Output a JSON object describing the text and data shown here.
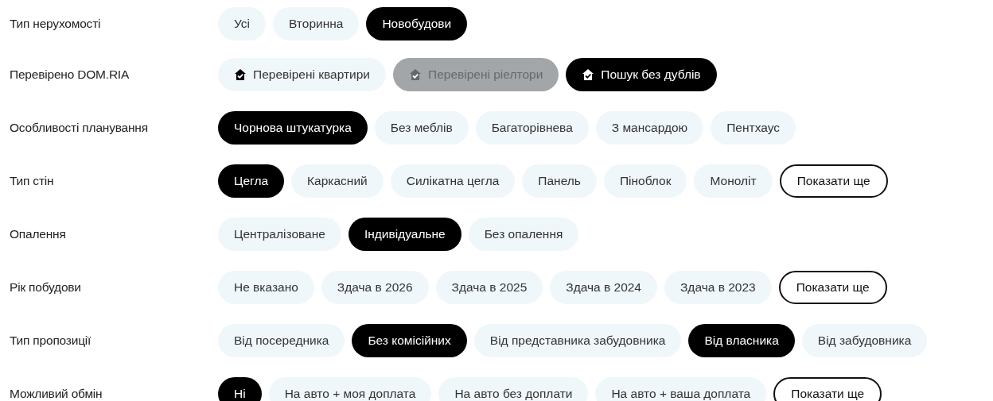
{
  "filters": [
    {
      "label": "Тип нерухомості",
      "options": [
        {
          "kind": "chip",
          "text": "Усі",
          "selected": false
        },
        {
          "kind": "chip",
          "text": "Вторинна",
          "selected": false
        },
        {
          "kind": "chip",
          "text": "Новобудови",
          "selected": true
        }
      ]
    },
    {
      "label": "Перевірено DOM.RIA",
      "options": [
        {
          "kind": "verified",
          "text": "Перевірені квартири",
          "selected": false,
          "disabled": false
        },
        {
          "kind": "verified",
          "text": "Перевірені ріелтори",
          "selected": false,
          "disabled": true
        },
        {
          "kind": "verified",
          "text": "Пошук без дублів",
          "selected": true,
          "disabled": false
        }
      ]
    },
    {
      "label": "Особливості планування",
      "options": [
        {
          "kind": "chip",
          "text": "Чорнова штукатурка",
          "selected": true
        },
        {
          "kind": "chip",
          "text": "Без меблів",
          "selected": false
        },
        {
          "kind": "chip",
          "text": "Багаторівнева",
          "selected": false
        },
        {
          "kind": "chip",
          "text": "З мансардою",
          "selected": false
        },
        {
          "kind": "chip",
          "text": "Пентхаус",
          "selected": false
        }
      ]
    },
    {
      "label": "Тип стін",
      "options": [
        {
          "kind": "chip",
          "text": "Цегла",
          "selected": true
        },
        {
          "kind": "chip",
          "text": "Каркасний",
          "selected": false
        },
        {
          "kind": "chip",
          "text": "Силікатна цегла",
          "selected": false
        },
        {
          "kind": "chip",
          "text": "Панель",
          "selected": false
        },
        {
          "kind": "chip",
          "text": "Піноблок",
          "selected": false
        },
        {
          "kind": "chip",
          "text": "Моноліт",
          "selected": false
        },
        {
          "kind": "more",
          "text": "Показати ще"
        }
      ]
    },
    {
      "label": "Опалення",
      "options": [
        {
          "kind": "chip",
          "text": "Централізоване",
          "selected": false
        },
        {
          "kind": "chip",
          "text": "Індивідуальне",
          "selected": true
        },
        {
          "kind": "chip",
          "text": "Без опалення",
          "selected": false
        }
      ]
    },
    {
      "label": "Рік побудови",
      "options": [
        {
          "kind": "chip",
          "text": "Не вказано",
          "selected": false
        },
        {
          "kind": "chip",
          "text": "Здача в 2026",
          "selected": false
        },
        {
          "kind": "chip",
          "text": "Здача в 2025",
          "selected": false
        },
        {
          "kind": "chip",
          "text": "Здача в 2024",
          "selected": false
        },
        {
          "kind": "chip",
          "text": "Здача в 2023",
          "selected": false
        },
        {
          "kind": "more",
          "text": "Показати ще"
        }
      ]
    },
    {
      "label": "Тип пропозиції",
      "options": [
        {
          "kind": "chip",
          "text": "Від посередника",
          "selected": false
        },
        {
          "kind": "chip",
          "text": "Без комісійних",
          "selected": true
        },
        {
          "kind": "chip",
          "text": "Від представника забудовника",
          "selected": false
        },
        {
          "kind": "chip",
          "text": "Від власника",
          "selected": true
        },
        {
          "kind": "chip",
          "text": "Від забудовника",
          "selected": false
        }
      ]
    },
    {
      "label": "Можливий обмін",
      "options": [
        {
          "kind": "chip",
          "text": "Ні",
          "selected": true
        },
        {
          "kind": "chip",
          "text": "На авто + моя доплата",
          "selected": false
        },
        {
          "kind": "chip",
          "text": "На авто без доплати",
          "selected": false
        },
        {
          "kind": "chip",
          "text": "На авто + ваша доплата",
          "selected": false
        },
        {
          "kind": "more",
          "text": "Показати ще"
        }
      ]
    }
  ]
}
